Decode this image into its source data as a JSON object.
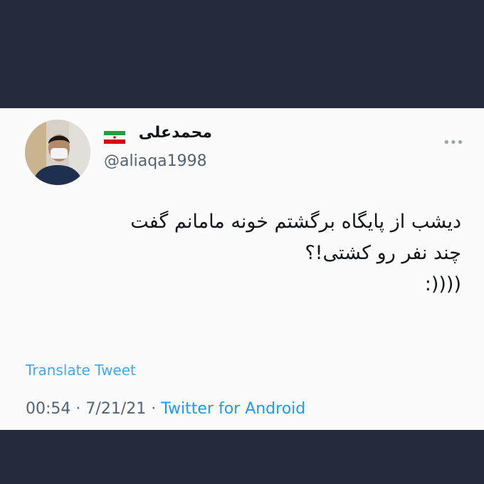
{
  "tweet": {
    "author": {
      "display_name": "محمدعلی",
      "handle": "@aliaqa1998",
      "avatar_icon": "avatar-photo-man-with-mask",
      "flag_icon": "iran-flag-icon"
    },
    "more_icon": "more-options-icon",
    "text_lines": [
      "دیشب از پایگاه برگشتم خونه مامانم گفت",
      "چند نفر رو کشتی!؟",
      "((((:"
    ],
    "translate_label": "Translate Tweet",
    "time": "00:54",
    "separator": "·",
    "date": "7/21/21",
    "source": "Twitter for Android"
  },
  "colors": {
    "frame_background": "#262b3b",
    "card_background": "#fbfbfb",
    "link_blue": "#1d9bf0",
    "muted_gray": "#536471"
  }
}
